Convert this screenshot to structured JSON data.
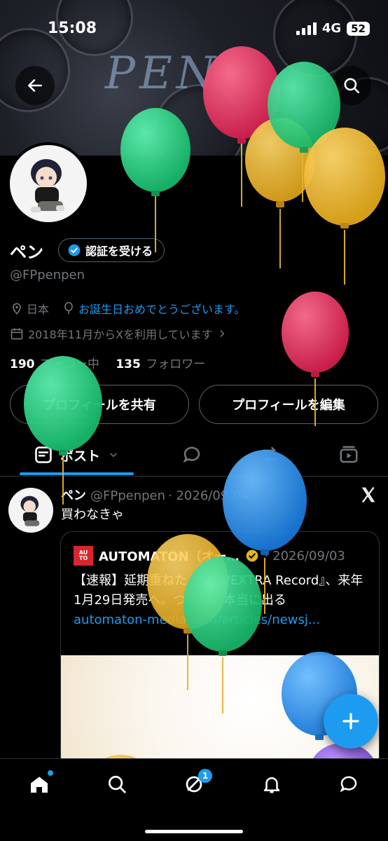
{
  "status_bar": {
    "time": "15:08",
    "network": "4G",
    "battery": "52"
  },
  "banner": {
    "title": "PEN"
  },
  "profile": {
    "display_name": "ペン",
    "verify_label": "認証を受ける",
    "handle": "@FPpenpen",
    "location": "日本",
    "birthday_text": "お誕生日おめでとうございます。",
    "joined": "2018年11月からXを利用しています",
    "following_count": "190",
    "following_label": "フォロー中",
    "followers_count": "135",
    "followers_label": "フォロワー",
    "share_button": "プロフィールを共有",
    "edit_button": "プロフィールを編集"
  },
  "tabs": {
    "posts_label": "ポスト"
  },
  "post": {
    "name": "ペン",
    "handle": "@FPpenpen",
    "date": "· 2026/09/04",
    "text": "買わなきゃ",
    "card": {
      "source": "AUTOMATON（オー…",
      "date": "· 2026/09/03",
      "text": "【速報】延期重ねた『Fate/EXTRA Record』、来年1月29日発売へ。ついに、本当に出る",
      "link": "automaton-media.com/articles/newsj..."
    }
  },
  "nav": {
    "messages_badge": "1"
  },
  "colors": {
    "accent": "#1d9bf0",
    "balloon_red": "#e0245e",
    "balloon_green": "#17bf63",
    "balloon_yellow": "#ffad1f",
    "balloon_blue": "#1d9bf0",
    "balloon_purple": "#794bc4"
  }
}
